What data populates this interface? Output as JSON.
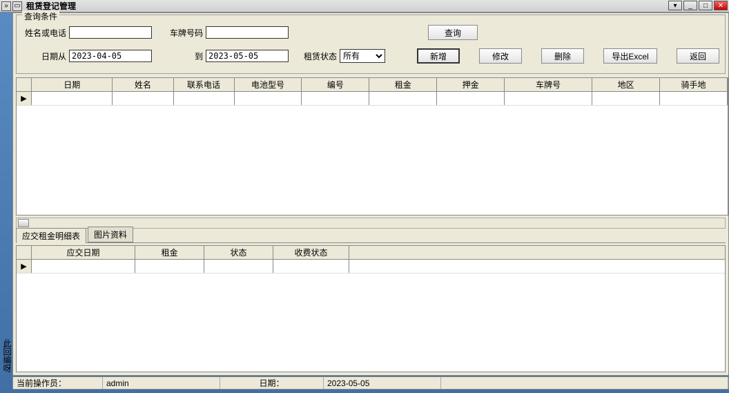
{
  "window": {
    "title": "租赁登记管理"
  },
  "groupbox": {
    "title": "查询条件",
    "labels": {
      "name_phone": "姓名或电话",
      "plate": "车牌号码",
      "date_from": "日期从",
      "date_to": "到",
      "lease_status": "租赁状态"
    },
    "inputs": {
      "name_phone": "",
      "plate": "",
      "date_from": "2023-04-05",
      "date_to": "2023-05-05"
    },
    "status_select": "所有",
    "buttons": {
      "query": "查询",
      "add": "新增",
      "edit": "修改",
      "del": "删除",
      "export": "导出Excel",
      "back": "返回"
    }
  },
  "grid1": {
    "headers": [
      "日期",
      "姓名",
      "联系电话",
      "电池型号",
      "编号",
      "租金",
      "押金",
      "车牌号",
      "地区",
      "骑手地"
    ]
  },
  "tabs": {
    "t1": "应交租金明细表",
    "t2": "图片资料"
  },
  "grid2": {
    "headers": [
      "应交日期",
      "租金",
      "状态",
      "收费状态"
    ]
  },
  "statusbar": {
    "operator_label": "当前操作员：",
    "operator_value": "admin",
    "date_label": "日期：",
    "date_value": "2023-05-05"
  },
  "side_text": "此回编呀"
}
